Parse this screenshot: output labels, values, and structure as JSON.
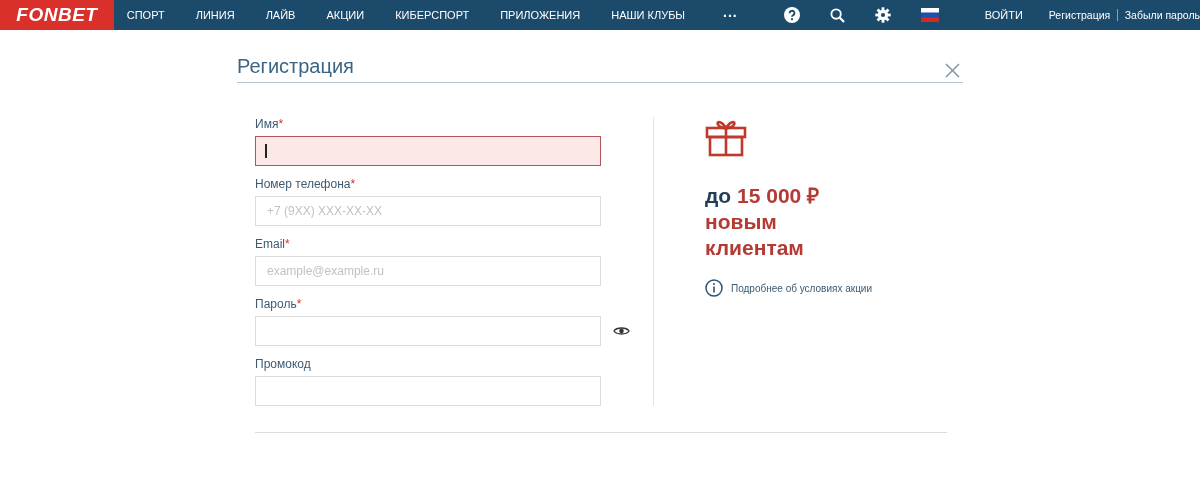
{
  "header": {
    "logo": "FONBET",
    "nav": [
      "СПОРТ",
      "ЛИНИЯ",
      "ЛАЙВ",
      "АКЦИИ",
      "КИБЕРСПОРТ",
      "ПРИЛОЖЕНИЯ",
      "НАШИ КЛУБЫ"
    ],
    "more": "...",
    "login": "ВОЙТИ",
    "register": "Регистрация",
    "forgot": "Забыли пароль"
  },
  "dialog": {
    "title": "Регистрация",
    "fields": [
      {
        "label": "Имя",
        "required_mark": "*",
        "kind": "text",
        "invalid": true,
        "focused": true
      },
      {
        "label": "Номер телефона",
        "required_mark": "*",
        "kind": "text",
        "invalid": false,
        "focused": false,
        "placeholder": "+7 (9XX) XXX-XX-XX"
      },
      {
        "label": "Email",
        "required_mark": "*",
        "kind": "text",
        "invalid": false,
        "focused": false,
        "placeholder": "example@example.ru"
      },
      {
        "label": "Пароль",
        "required_mark": "*",
        "kind": "password",
        "invalid": false,
        "focused": false
      },
      {
        "label": "Промокод",
        "kind": "text",
        "invalid": false,
        "focused": false
      }
    ],
    "promo": {
      "lead": "до",
      "amount": "15 000 ₽",
      "rest": "новым клиентам",
      "details_link": "Подробнее об условиях акции"
    }
  }
}
